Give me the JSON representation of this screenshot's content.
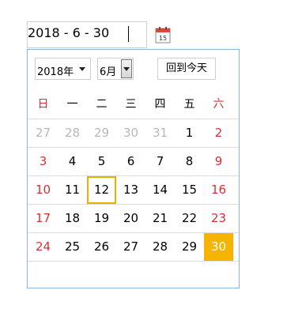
{
  "date_input": {
    "value": "2018 - 6 - 30",
    "calendar_icon_text": "15"
  },
  "toolbar": {
    "year_value": "2018年",
    "month_value": "6月",
    "today_button": "回到今天"
  },
  "weekdays": [
    "日",
    "一",
    "二",
    "三",
    "四",
    "五",
    "六"
  ],
  "weeks": [
    [
      "27",
      "28",
      "29",
      "30",
      "31",
      "1",
      "2"
    ],
    [
      "3",
      "4",
      "5",
      "6",
      "7",
      "8",
      "9"
    ],
    [
      "10",
      "11",
      "12",
      "13",
      "14",
      "15",
      "16"
    ],
    [
      "17",
      "18",
      "19",
      "20",
      "21",
      "22",
      "23"
    ],
    [
      "24",
      "25",
      "26",
      "27",
      "28",
      "29",
      "30"
    ]
  ],
  "colors": {
    "weekend": "#d93030",
    "other_month": "#b8b8b8",
    "today_border": "#e8b000",
    "selected_bg": "#f4b400"
  },
  "icons": {
    "calendar": "calendar-icon"
  }
}
